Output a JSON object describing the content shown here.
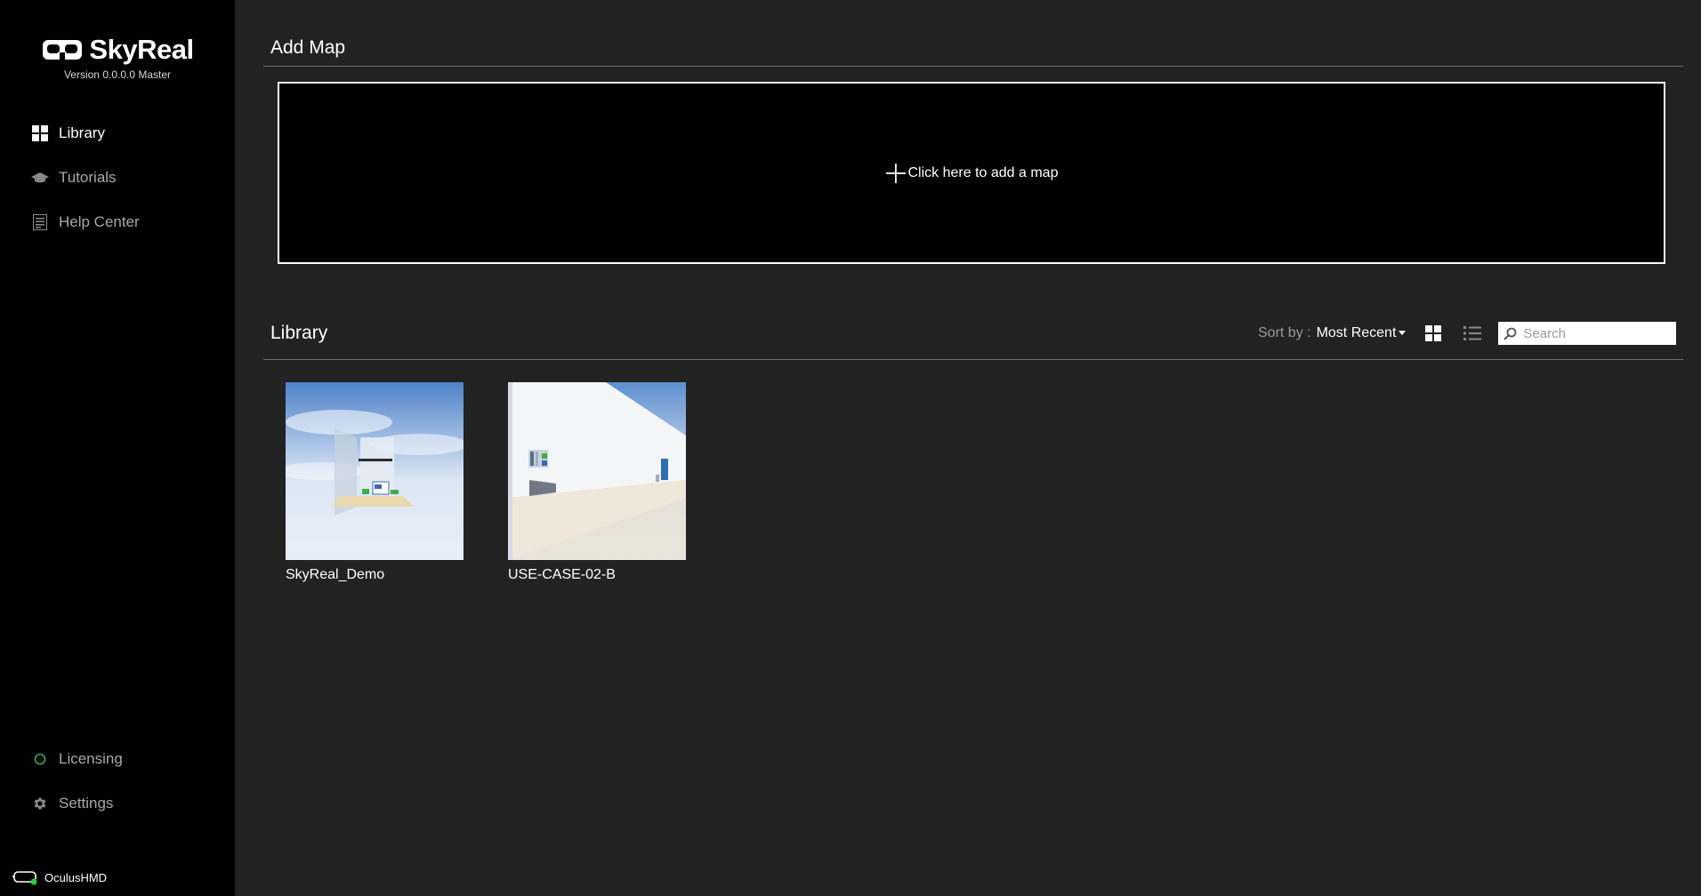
{
  "app": {
    "name": "SkyReal",
    "version": "Version 0.0.0.0 Master"
  },
  "sidebar": {
    "items": [
      {
        "label": "Library",
        "icon": "grid-icon",
        "active": true
      },
      {
        "label": "Tutorials",
        "icon": "graduation-cap-icon",
        "active": false
      },
      {
        "label": "Help Center",
        "icon": "document-icon",
        "active": false
      }
    ],
    "bottom_items": [
      {
        "label": "Licensing",
        "icon": "status-circle-icon"
      },
      {
        "label": "Settings",
        "icon": "gear-icon"
      }
    ],
    "device": {
      "label": "OculusHMD",
      "icon": "vr-headset-icon",
      "status_color": "#2ecc40"
    }
  },
  "add_map": {
    "title": "Add Map",
    "button_label": "Click here to add a map"
  },
  "library": {
    "title": "Library",
    "sort_label": "Sort by :",
    "sort_value": "Most Recent",
    "search_placeholder": "Search",
    "items": [
      {
        "name": "SkyReal_Demo"
      },
      {
        "name": "USE-CASE-02-B"
      }
    ]
  },
  "colors": {
    "sidebar_bg": "#000000",
    "main_bg": "#222222",
    "licensing_green": "#3fae49"
  }
}
